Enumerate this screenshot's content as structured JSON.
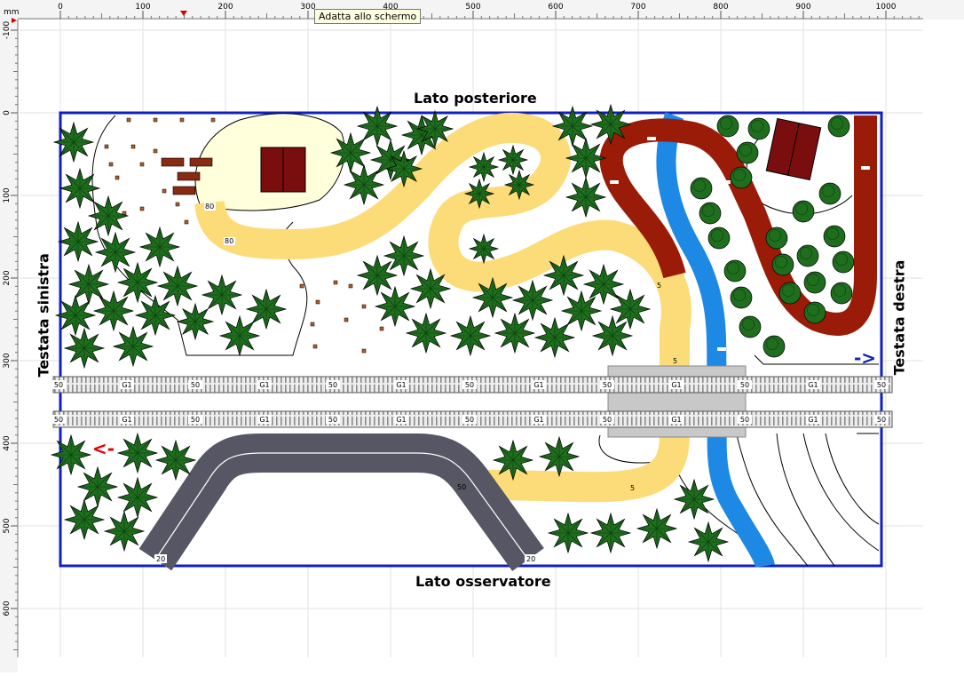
{
  "ruler": {
    "unit": "mm",
    "h_ticks": [
      "0",
      "100",
      "200",
      "300",
      "400",
      "500",
      "600",
      "700",
      "800",
      "900",
      "1000"
    ],
    "v_ticks": [
      "-100",
      "0",
      "100",
      "200",
      "300",
      "400",
      "500",
      "600"
    ]
  },
  "tooltip": "Adatta allo schermo",
  "labels": {
    "top": "Lato posteriore",
    "bottom": "Lato osservatore",
    "left": "Testata sinistra",
    "right": "Testata destra"
  },
  "track_labels": {
    "end": "50",
    "mid": "G1",
    "road_a": "80",
    "road_b": "5",
    "gray_road": "20"
  },
  "arrows": {
    "left": "<-",
    "right": "->"
  },
  "colors": {
    "frame": "#1020c0",
    "sand": "#fcdc78",
    "river": "#1e88e5",
    "red_road": "#9a1c08",
    "gray_road": "#565664",
    "tree": "#1e6e1e",
    "house": "#7a0e0e",
    "meadow": "#ffffdc"
  }
}
